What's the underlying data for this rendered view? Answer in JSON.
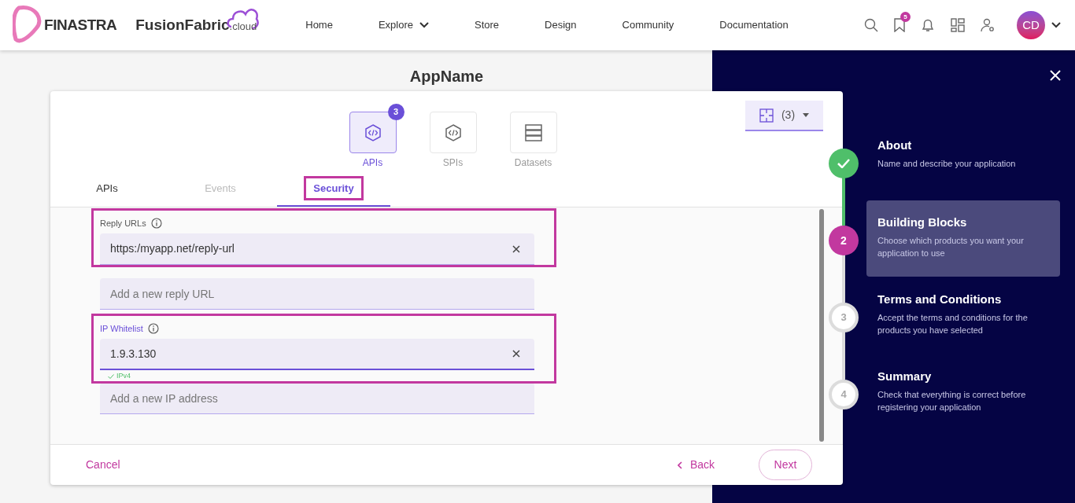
{
  "header": {
    "logo_primary": "FINASTRA",
    "logo_secondary": "FusionFabric",
    "logo_suffix": ".cloud",
    "nav": [
      {
        "label": "Home",
        "has_dropdown": false
      },
      {
        "label": "Explore",
        "has_dropdown": true
      },
      {
        "label": "Store",
        "has_dropdown": false
      },
      {
        "label": "Design",
        "has_dropdown": false
      },
      {
        "label": "Community",
        "has_dropdown": false
      },
      {
        "label": "Documentation",
        "has_dropdown": false
      }
    ],
    "bookmark_count": "5",
    "avatar": "CD"
  },
  "page_title": "AppName",
  "block_types": [
    {
      "label": "APIs",
      "kind": "api",
      "selected": true,
      "count": "3"
    },
    {
      "label": "SPIs",
      "kind": "api",
      "selected": false
    },
    {
      "label": "Datasets",
      "kind": "dataset",
      "selected": false
    }
  ],
  "selector": {
    "count": "(3)"
  },
  "tabs": [
    {
      "label": "APIs",
      "selected": false,
      "disabled": false
    },
    {
      "label": "Events",
      "selected": false,
      "disabled": true
    },
    {
      "label": "Security",
      "selected": true,
      "disabled": false
    }
  ],
  "fields": [
    {
      "label": "Reply URLs",
      "focused": false,
      "highlighted": true,
      "value": "https:/myapp.net/reply-url",
      "placeholder": "Add a new reply URL"
    },
    {
      "label": "IP Whitelist",
      "focused": true,
      "highlighted": true,
      "value": "1.9.3.130",
      "hint": "IPv4",
      "placeholder": "Add a new IP address"
    }
  ],
  "footer": {
    "cancel": "Cancel",
    "back": "Back",
    "next": "Next"
  },
  "steps": [
    {
      "completed": true,
      "title": "About",
      "description": "Name and describe your application",
      "selected": false
    },
    {
      "completed": false,
      "number": "2",
      "title": "Building Blocks",
      "description": "Choose which products you want your application to use",
      "selected": true
    },
    {
      "completed": false,
      "number": "3",
      "title": "Terms and Conditions",
      "description": "Accept the terms and conditions for the products you have selected",
      "selected": false
    },
    {
      "completed": false,
      "number": "4",
      "title": "Summary",
      "description": "Check that everything is correct before registering your application",
      "selected": false
    }
  ]
}
